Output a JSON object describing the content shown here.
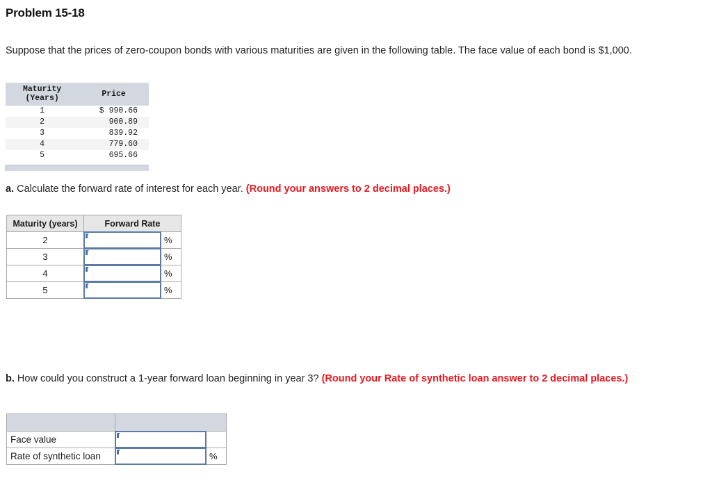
{
  "problem": {
    "title": "Problem 15-18",
    "intro": "Suppose that the prices of zero-coupon bonds with various maturities are given in the following table. The face value of each bond is $1,000."
  },
  "given_table": {
    "headers": {
      "maturity_line1": "Maturity",
      "maturity_line2": "(Years)",
      "price": "Price"
    },
    "rows": [
      {
        "maturity": "1",
        "price": "$ 990.66"
      },
      {
        "maturity": "2",
        "price": "900.89"
      },
      {
        "maturity": "3",
        "price": "839.92"
      },
      {
        "maturity": "4",
        "price": "779.60"
      },
      {
        "maturity": "5",
        "price": "695.66"
      }
    ]
  },
  "question_a": {
    "letter": "a.",
    "text": "Calculate the forward rate of interest for each year.",
    "note": "(Round your answers to 2 decimal places.)"
  },
  "forward_rate_table": {
    "headers": {
      "maturity": "Maturity (years)",
      "forward_rate": "Forward Rate"
    },
    "percent_symbol": "%",
    "rows": [
      {
        "maturity": "2",
        "value": "",
        "percent": "%"
      },
      {
        "maturity": "3",
        "value": "",
        "percent": "%"
      },
      {
        "maturity": "4",
        "value": "",
        "percent": "%"
      },
      {
        "maturity": "5",
        "value": "",
        "percent": "%"
      }
    ]
  },
  "question_b": {
    "letter": "b.",
    "text": "How could you construct a 1-year forward loan beginning in year 3?",
    "note": "(Round your Rate of synthetic loan answer to 2 decimal places.)"
  },
  "synthetic_loan_table": {
    "headers": {
      "label": "",
      "value": ""
    },
    "rows": [
      {
        "label": "Face value",
        "value": "",
        "percent": ""
      },
      {
        "label": "Rate of synthetic loan",
        "value": "",
        "percent": "%"
      }
    ]
  },
  "colors": {
    "header_blue_gray": "#d3d8e0",
    "header_gray": "#e6e6e6",
    "stripe": "#f4f4f4",
    "input_border": "#5b7ba6",
    "input_marker": "#4a6fa5",
    "note_red": "#e8171f",
    "table_border": "#a8a8a8"
  }
}
